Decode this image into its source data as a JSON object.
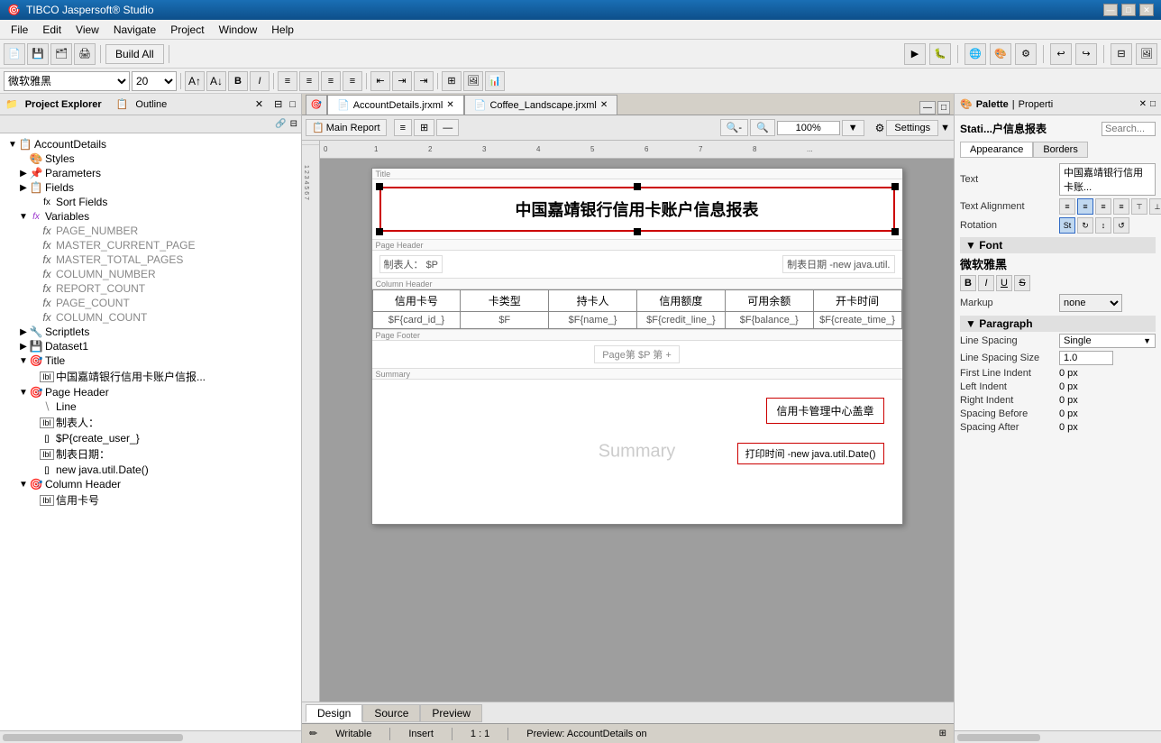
{
  "titlebar": {
    "text": "TIBCO Jaspersoft® Studio",
    "buttons": [
      "—",
      "□",
      "✕"
    ]
  },
  "menubar": {
    "items": [
      "File",
      "Edit",
      "View",
      "Navigate",
      "Project",
      "Window",
      "Help"
    ]
  },
  "toolbar": {
    "build_all_label": "Build All"
  },
  "format_bar": {
    "font": "微软雅黑",
    "font_size": "20"
  },
  "left_panel": {
    "tabs": [
      "Project Explorer",
      "Outline"
    ],
    "tree": [
      {
        "level": 0,
        "arrow": "▼",
        "icon": "📁",
        "label": "AccountDetails",
        "type": "root"
      },
      {
        "level": 1,
        "arrow": "",
        "icon": "🎨",
        "label": "Styles",
        "type": "styles"
      },
      {
        "level": 1,
        "arrow": "▶",
        "icon": "📌",
        "label": "Parameters",
        "type": "params"
      },
      {
        "level": 1,
        "arrow": "▶",
        "icon": "📋",
        "label": "Fields",
        "type": "fields"
      },
      {
        "level": 2,
        "arrow": "",
        "icon": "fx",
        "label": "Sort Fields",
        "type": "sortfields"
      },
      {
        "level": 1,
        "arrow": "▼",
        "icon": "fx",
        "label": "Variables",
        "type": "variables"
      },
      {
        "level": 2,
        "arrow": "",
        "icon": "fx",
        "label": "PAGE_NUMBER",
        "type": "var"
      },
      {
        "level": 2,
        "arrow": "",
        "icon": "fx",
        "label": "MASTER_CURRENT_PAGE",
        "type": "var"
      },
      {
        "level": 2,
        "arrow": "",
        "icon": "fx",
        "label": "MASTER_TOTAL_PAGES",
        "type": "var"
      },
      {
        "level": 2,
        "arrow": "",
        "icon": "fx",
        "label": "COLUMN_NUMBER",
        "type": "var"
      },
      {
        "level": 2,
        "arrow": "",
        "icon": "fx",
        "label": "REPORT_COUNT",
        "type": "var"
      },
      {
        "level": 2,
        "arrow": "",
        "icon": "fx",
        "label": "PAGE_COUNT",
        "type": "var"
      },
      {
        "level": 2,
        "arrow": "",
        "icon": "fx",
        "label": "COLUMN_COUNT",
        "type": "var"
      },
      {
        "level": 1,
        "arrow": "▶",
        "icon": "🔧",
        "label": "Scriptlets",
        "type": "scriptlets"
      },
      {
        "level": 1,
        "arrow": "▶",
        "icon": "💾",
        "label": "Dataset1",
        "type": "dataset"
      },
      {
        "level": 1,
        "arrow": "▼",
        "icon": "🎯",
        "label": "Title",
        "type": "band"
      },
      {
        "level": 2,
        "arrow": "",
        "icon": "lbl",
        "label": "中国嘉靖银行信用卡账户信报...",
        "type": "label"
      },
      {
        "level": 1,
        "arrow": "▼",
        "icon": "🎯",
        "label": "Page Header",
        "type": "band"
      },
      {
        "level": 2,
        "arrow": "",
        "icon": "—",
        "label": "Line",
        "type": "line"
      },
      {
        "level": 2,
        "arrow": "",
        "icon": "lbl",
        "label": "制表人：",
        "type": "label"
      },
      {
        "level": 2,
        "arrow": "",
        "icon": "[]",
        "label": "$P{create_user_}",
        "type": "field"
      },
      {
        "level": 2,
        "arrow": "",
        "icon": "lbl",
        "label": "制表日期：",
        "type": "label"
      },
      {
        "level": 2,
        "arrow": "",
        "icon": "[]",
        "label": "new java.util.Date()",
        "type": "field"
      },
      {
        "level": 1,
        "arrow": "▼",
        "icon": "🎯",
        "label": "Column Header",
        "type": "band"
      },
      {
        "level": 2,
        "arrow": "",
        "icon": "lbl",
        "label": "信用卡号",
        "type": "label"
      }
    ]
  },
  "editor": {
    "tabs": [
      {
        "label": "AccountDetails.jrxml",
        "active": true,
        "closeable": true
      },
      {
        "label": "Coffee_Landscape.jrxml",
        "active": false,
        "closeable": true
      }
    ],
    "active_report_tab": "Main Report",
    "zoom": "100%",
    "settings_label": "Settings"
  },
  "report": {
    "title": "中国嘉靖银行信用卡账户信息报表",
    "page_header": {
      "left": "制表人：$P",
      "right": "制表日期 -new java.util."
    },
    "columns": {
      "headers": [
        "信用卡号",
        "卡类型",
        "持卡人",
        "信用额度",
        "可用余额",
        "开卡时间"
      ],
      "data": [
        "$F{card_id_}",
        "$F",
        "$F{name_}",
        "$F{credit_line_}",
        "$F{balance_}",
        "$F{create_time_}"
      ]
    },
    "page_footer": "Page第页$P 第 +",
    "summary": {
      "label": "Summary",
      "stamp": "信用卡管理中心盖章",
      "print_time": "打印时间 -new java.util.Date()"
    }
  },
  "bottom_tabs": [
    "Design",
    "Source",
    "Preview"
  ],
  "status_bar": {
    "writable": "Writable",
    "insert": "Insert",
    "position": "1 : 1",
    "preview": "Preview: AccountDetails on"
  },
  "right_panel": {
    "title": "Stati...户信息报表",
    "search_placeholder": "Search...",
    "palette_tab": "Palette",
    "properties_tab": "Properti",
    "appearance_tab": "Appearance",
    "borders_tab": "Borders",
    "text_label": "Text",
    "text_value": "中国嘉靖银行信用卡账...",
    "text_alignment_label": "Text Alignment",
    "rotation_label": "Rotation",
    "font_section": "Font",
    "font_name": "微软雅黑",
    "markup_label": "Markup",
    "markup_value": "none",
    "paragraph_section": "Paragraph",
    "line_spacing_label": "Line Spacing",
    "line_spacing_value": "Single",
    "line_spacing_size_label": "Line Spacing Size",
    "line_spacing_size_value": "1.0",
    "first_line_indent_label": "First Line Indent",
    "first_line_indent_value": "0 px",
    "left_indent_label": "Left Indent",
    "left_indent_value": "0 px",
    "right_indent_label": "Right Indent",
    "right_indent_value": "0 px",
    "spacing_before_label": "Spacing Before",
    "spacing_before_value": "0 px",
    "spacing_after_label": "Spacing After",
    "spacing_after_value": "0 px"
  }
}
